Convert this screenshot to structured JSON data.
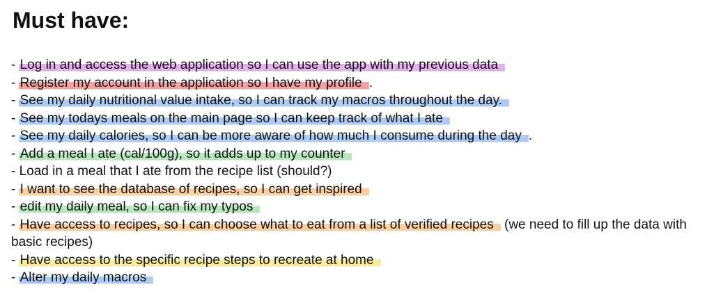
{
  "heading": "Must have:",
  "bullet": "- ",
  "colors": {
    "purple": "#e3b0ec",
    "red": "#f2a1a1",
    "blue": "#aecbf3",
    "green": "#b7e7bd",
    "orange": "#f7cfa2",
    "yellow": "#f8ec9f"
  },
  "items": [
    {
      "text": "Log in and access the web application so I can use the app with my previous data",
      "highlight": "purple",
      "tail": ""
    },
    {
      "text": "Register my account in the application so I have my profile",
      "highlight": "red",
      "tail": "."
    },
    {
      "text": "See my daily nutritional value intake, so I can track my macros throughout the day.",
      "highlight": "blue",
      "tail": ""
    },
    {
      "text": "See my todays meals on the main page so I can keep track of what I ate",
      "highlight": "blue",
      "tail": ""
    },
    {
      "text": "See my daily calories, so I can be more aware of how much I consume during the day",
      "highlight": "blue",
      "tail": "."
    },
    {
      "text": "Add a meal I ate (cal/100g), so it adds up to my counter",
      "highlight": "green",
      "tail": ""
    },
    {
      "text": "Load in a meal that I ate from the recipe list (should?)",
      "highlight": "",
      "tail": ""
    },
    {
      "text": "I want to see the database of recipes, so I can get inspired",
      "highlight": "orange",
      "tail": ""
    },
    {
      "text": "edit my daily meal, so I can fix my typos",
      "highlight": "green",
      "tail": ""
    },
    {
      "text": "Have access to recipes, so I can choose what to eat from a list of verified recipes",
      "highlight": "orange",
      "tail": " (we need to fill up the data with basic recipes)"
    },
    {
      "text": "Have access to the specific recipe steps to recreate at home",
      "highlight": "yellow",
      "tail": ""
    },
    {
      "text": "Alter my daily macros",
      "highlight": "blue",
      "tail": ""
    }
  ]
}
